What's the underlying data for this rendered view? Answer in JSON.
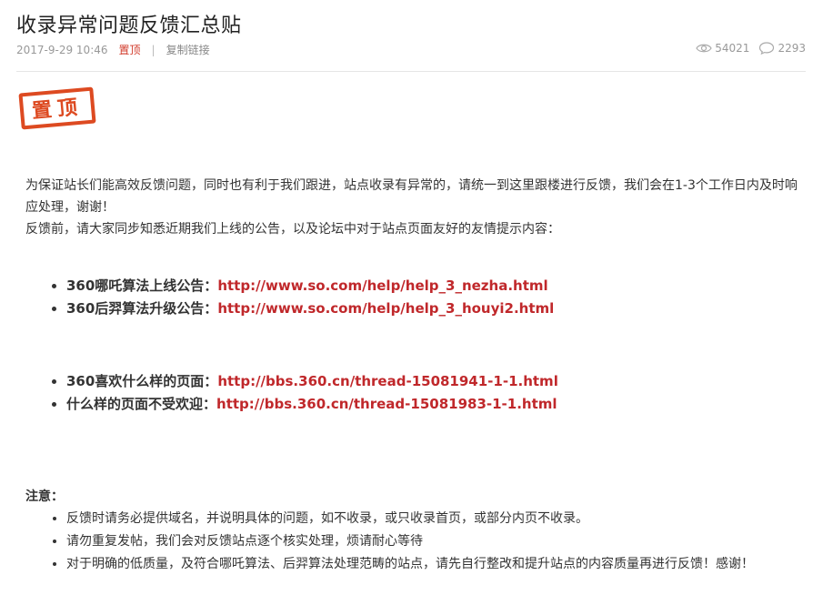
{
  "post": {
    "title": "收录异常问题反馈汇总贴",
    "date": "2017-9-29 10:46",
    "pinned_label": "置顶",
    "separator": "|",
    "copy_link_label": "复制链接",
    "views": "54021",
    "comments": "2293",
    "stamp_text": "置顶"
  },
  "body": {
    "intro_1": "为保证站长们能高效反馈问题，同时也有利于我们跟进，站点收录有异常的，请统一到这里跟楼进行反馈，我们会在1-3个工作日内及时响应处理，谢谢！",
    "intro_2": "反馈前，请大家同步知悉近期我们上线的公告，以及论坛中对于站点页面友好的友情提示内容：",
    "links_group1": [
      {
        "label": "360哪吒算法上线公告：",
        "url": "http://www.so.com/help/help_3_nezha.html"
      },
      {
        "label": "360后羿算法升级公告：",
        "url": "http://www.so.com/help/help_3_houyi2.html"
      }
    ],
    "links_group2": [
      {
        "label": "360喜欢什么样的页面：",
        "url": "http://bbs.360.cn/thread-15081941-1-1.html"
      },
      {
        "label": "什么样的页面不受欢迎：",
        "url": "http://bbs.360.cn/thread-15081983-1-1.html"
      }
    ],
    "note_title": "注意：",
    "notes": [
      "反馈时请务必提供域名，并说明具体的问题，如不收录，或只收录首页，或部分内页不收录。",
      "请勿重复发帖，我们会对反馈站点逐个核实处理，烦请耐心等待",
      "对于明确的低质量，及符合哪吒算法、后羿算法处理范畴的站点，请先自行整改和提升站点的内容质量再进行反馈！感谢！"
    ]
  },
  "colors": {
    "accent_red": "#c0282b",
    "stamp_red": "#dd4a21",
    "meta_gray": "#999999"
  },
  "icons": [
    "eye-icon",
    "comment-icon"
  ]
}
